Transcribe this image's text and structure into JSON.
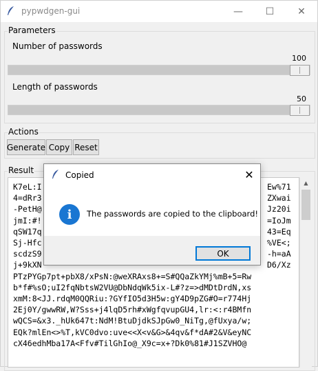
{
  "window": {
    "title": "pypwdgen-gui",
    "minimize_glyph": "—",
    "maximize_glyph": "☐",
    "close_glyph": "✕"
  },
  "parameters": {
    "legend": "Parameters",
    "num_label": "Number of passwords",
    "num_value": "100",
    "num_level": 1.0,
    "len_label": "Length of passwords",
    "len_value": "50",
    "len_level": 1.0
  },
  "actions": {
    "legend": "Actions",
    "generate": "Generate",
    "copy": "Copy",
    "reset": "Reset"
  },
  "result": {
    "legend": "Result",
    "text": "K7eL:I\n4=dRr3\n-PetH@\njmI:#!\nqSW17q\nSj-Hfc\nscdzS9\nj+9kXN\nPTzPYGp7pt+pbX8/xPsN:@weXRAxs8+=S#QQaZkYMj%mB+5=Rw\nb*f#%sO;uI2fqNbtsW2VU@DbNdqWk5ix-L#?z=>dMDtDrdN,xs\nxmM:8<JJ.rdqM0QQRiu:?GYfIO5d3H5w:gY4D9pZG#O=r774Hj\n2Ej0Y/gwwRW,W?Sss+j4lqD5rh#xWgfqvupGU4,lr:<:r4BMfn\nwQCS=&x3._hUk647t:NdM!BtuDjdkSJpGw0_NiTg,@fUxya/w;\nEQk?mlEn<>%T,kVC0dvo:uve<<X<v&G>&4qv&f*dA#2&V&eyNC\ncX46edhMba17A<Ffv#TilGhIo@_X9c=x+?Dk0%81#J1SZVHO@",
    "right_fragments": [
      "Ew%71",
      "ZXwai",
      "Jz20i",
      "=IoJm",
      "43=Eq",
      "%VE<;",
      "-h=aA",
      "D6/Xz"
    ],
    "scroll_up_glyph": "▲"
  },
  "dialog": {
    "title": "Copied",
    "close_glyph": "✕",
    "icon_glyph": "i",
    "message": "The passwords are copied to the clipboard!",
    "ok_label": "OK"
  },
  "colors": {
    "accent": "#0078d7",
    "info_icon": "#1976d2"
  }
}
